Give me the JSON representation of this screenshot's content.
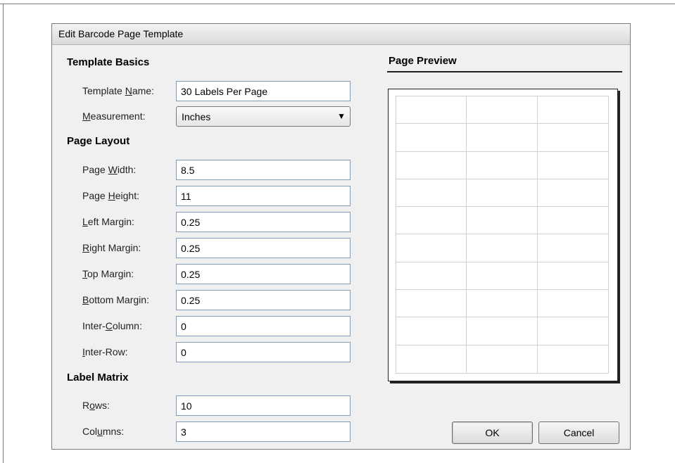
{
  "window": {
    "title": "Edit Barcode Page Template"
  },
  "sections": {
    "basics": "Template Basics",
    "layout": "Page Layout",
    "matrix": "Label Matrix"
  },
  "fields": {
    "template_name": {
      "label_before": "Template ",
      "label_key": "N",
      "label_after": "ame:",
      "value": "30 Labels Per Page"
    },
    "measurement": {
      "label_before": "",
      "label_key": "M",
      "label_after": "easurement:",
      "value": "Inches"
    },
    "page_width": {
      "label_before": "Page ",
      "label_key": "W",
      "label_after": "idth:",
      "value": "8.5"
    },
    "page_height": {
      "label_before": "Page ",
      "label_key": "H",
      "label_after": "eight:",
      "value": "11"
    },
    "left_margin": {
      "label_before": "",
      "label_key": "L",
      "label_after": "eft Margin:",
      "value": "0.25"
    },
    "right_margin": {
      "label_before": "",
      "label_key": "R",
      "label_after": "ight Margin:",
      "value": "0.25"
    },
    "top_margin": {
      "label_before": "",
      "label_key": "T",
      "label_after": "op Margin:",
      "value": "0.25"
    },
    "bottom_margin": {
      "label_before": "",
      "label_key": "B",
      "label_after": "ottom Margin:",
      "value": "0.25"
    },
    "inter_column": {
      "label_before": "Inter-",
      "label_key": "C",
      "label_after": "olumn:",
      "value": "0"
    },
    "inter_row": {
      "label_before": "",
      "label_key": "I",
      "label_after": "nter-Row:",
      "value": "0"
    },
    "rows": {
      "label_before": "R",
      "label_key": "o",
      "label_after": "ws:",
      "value": "10"
    },
    "columns": {
      "label_before": "Col",
      "label_key": "u",
      "label_after": "mns:",
      "value": "3"
    }
  },
  "preview": {
    "heading": "Page Preview",
    "rows": 10,
    "columns": 3
  },
  "buttons": {
    "ok": "OK",
    "cancel": "Cancel"
  }
}
